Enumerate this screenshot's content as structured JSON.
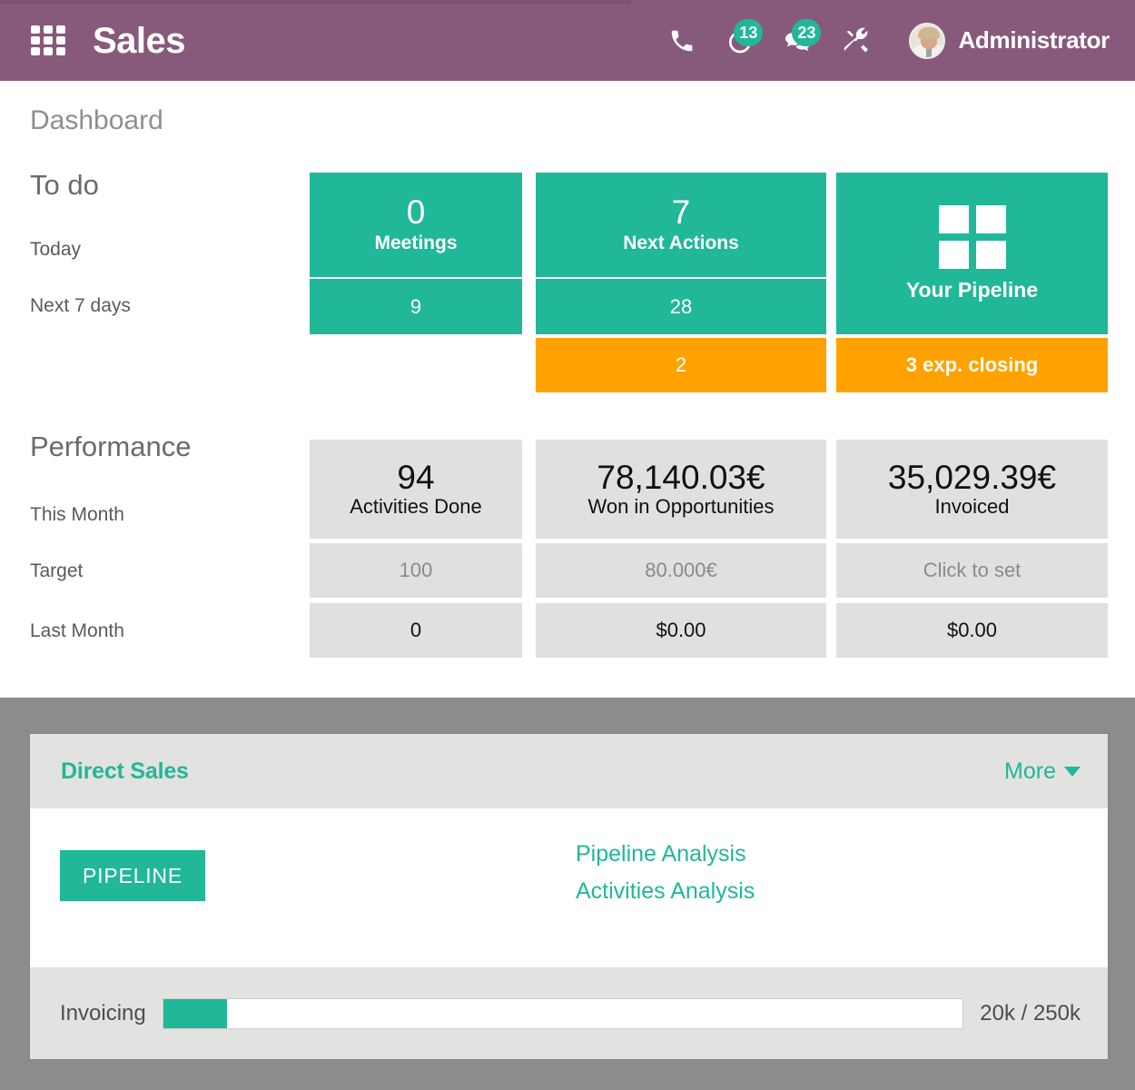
{
  "header": {
    "app_title": "Sales",
    "apps_icon": "apps-grid-icon",
    "icons": [
      {
        "name": "phone-icon",
        "badge": null
      },
      {
        "name": "activity-clock-icon",
        "badge": "13"
      },
      {
        "name": "messages-icon",
        "badge": "23"
      },
      {
        "name": "tools-icon",
        "badge": null
      }
    ],
    "user_name": "Administrator",
    "brand_color": "#875a7b",
    "accent_color": "#21b799"
  },
  "dashboard": {
    "title": "Dashboard",
    "todo": {
      "section_label": "To do",
      "row_labels": [
        "Today",
        "Next 7 days"
      ],
      "columns": [
        {
          "key": "meetings",
          "today_value": "0",
          "today_caption": "Meetings",
          "next7_value": "9",
          "alert_value": null
        },
        {
          "key": "next-actions",
          "today_value": "7",
          "today_caption": "Next Actions",
          "next7_value": "28",
          "alert_value": "2"
        },
        {
          "key": "your-pipeline",
          "icon": "pipeline-grid-icon",
          "label": "Your Pipeline",
          "alert_value": "3 exp. closing"
        }
      ]
    },
    "performance": {
      "section_label": "Performance",
      "row_labels": [
        "This Month",
        "Target",
        "Last Month"
      ],
      "columns": [
        {
          "key": "activities-done",
          "this_month_value": "94",
          "this_month_caption": "Activities Done",
          "target_value": "100",
          "last_month_value": "0"
        },
        {
          "key": "won-in-opportunities",
          "this_month_value": "78,140.03€",
          "this_month_caption": "Won in Opportunities",
          "target_value": "80.000€",
          "last_month_value": "$0.00"
        },
        {
          "key": "invoiced",
          "this_month_value": "35,029.39€",
          "this_month_caption": "Invoiced",
          "target_value": "Click to set",
          "last_month_value": "$0.00"
        }
      ]
    }
  },
  "team_card": {
    "title": "Direct Sales",
    "more_label": "More",
    "pipeline_button": "PIPELINE",
    "links": [
      "Pipeline Analysis",
      "Activities Analysis"
    ],
    "invoicing": {
      "label": "Invoicing",
      "value_text": "20k / 250k",
      "percent": 8
    }
  }
}
